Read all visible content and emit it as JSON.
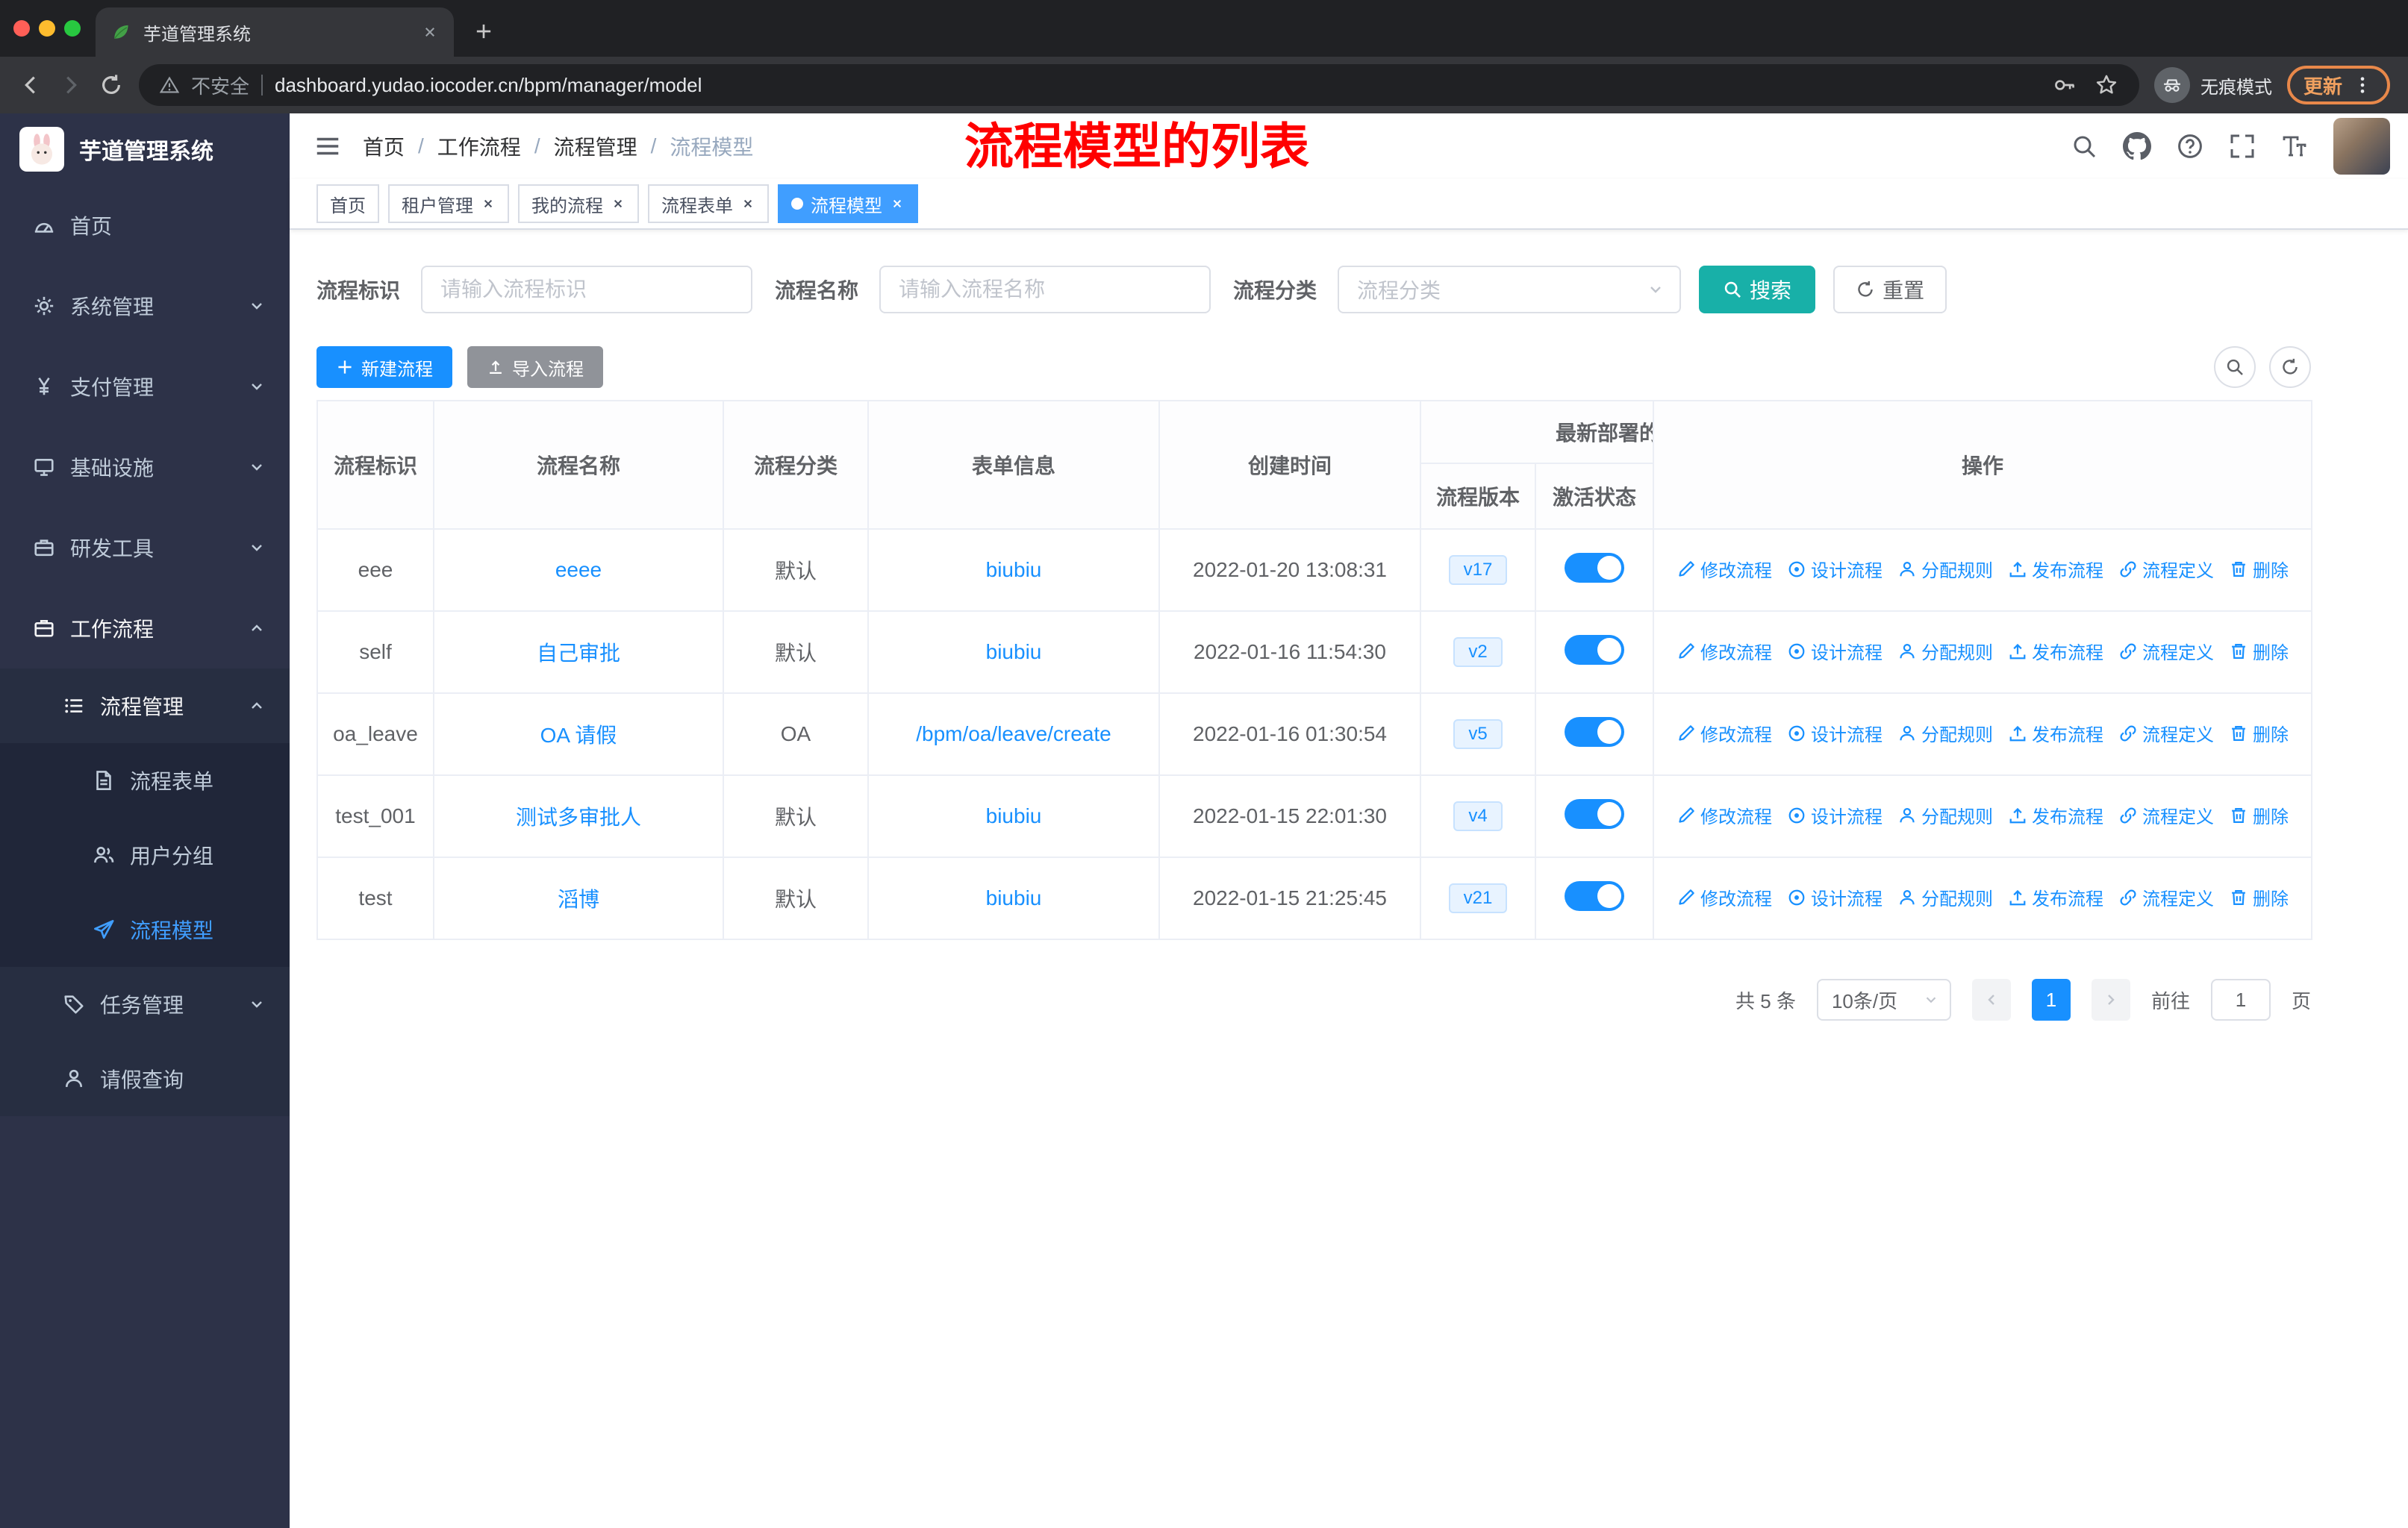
{
  "colors": {
    "accent_blue": "#1890ff",
    "menu_active_blue": "#409eff",
    "search_button_teal": "#18b0a8",
    "sidebar_background": "#2d3248",
    "annotation_red": "#ff0000",
    "update_orange": "#e8884a"
  },
  "browser": {
    "tab_title": "芋道管理系统",
    "security_label": "不安全",
    "url": "dashboard.yudao.iocoder.cn/bpm/manager/model",
    "incognito_label": "无痕模式",
    "update_label": "更新"
  },
  "sidebar": {
    "logo_title": "芋道管理系统",
    "items": [
      {
        "label": "首页"
      },
      {
        "label": "系统管理"
      },
      {
        "label": "支付管理"
      },
      {
        "label": "基础设施"
      },
      {
        "label": "研发工具"
      },
      {
        "label": "工作流程"
      },
      {
        "label": "流程管理"
      },
      {
        "label": "流程表单"
      },
      {
        "label": "用户分组"
      },
      {
        "label": "流程模型"
      },
      {
        "label": "任务管理"
      },
      {
        "label": "请假查询"
      }
    ]
  },
  "header": {
    "breadcrumb": [
      "首页",
      "工作流程",
      "流程管理",
      "流程模型"
    ],
    "annotation": "流程模型的列表"
  },
  "tabs": [
    {
      "label": "首页"
    },
    {
      "label": "租户管理"
    },
    {
      "label": "我的流程"
    },
    {
      "label": "流程表单"
    },
    {
      "label": "流程模型"
    }
  ],
  "filters": {
    "key_label": "流程标识",
    "key_placeholder": "请输入流程标识",
    "name_label": "流程名称",
    "name_placeholder": "请输入流程名称",
    "category_label": "流程分类",
    "category_placeholder": "流程分类",
    "search_label": "搜索",
    "reset_label": "重置"
  },
  "toolbar": {
    "create_label": "新建流程",
    "import_label": "导入流程"
  },
  "table": {
    "headers": {
      "key": "流程标识",
      "name": "流程名称",
      "category": "流程分类",
      "form": "表单信息",
      "created": "创建时间",
      "group": "最新部署的",
      "version": "流程版本",
      "active": "激活状态",
      "ops": "操作"
    },
    "actions": [
      "修改流程",
      "设计流程",
      "分配规则",
      "发布流程",
      "流程定义",
      "删除"
    ],
    "rows": [
      {
        "key": "eee",
        "name": "eeee",
        "category": "默认",
        "form": "biubiu",
        "created": "2022-01-20 13:08:31",
        "version": "v17"
      },
      {
        "key": "self",
        "name": "自己审批",
        "category": "默认",
        "form": "biubiu",
        "created": "2022-01-16 11:54:30",
        "version": "v2"
      },
      {
        "key": "oa_leave",
        "name": "OA 请假",
        "category": "OA",
        "form": "/bpm/oa/leave/create",
        "created": "2022-01-16 01:30:54",
        "version": "v5"
      },
      {
        "key": "test_001",
        "name": "测试多审批人",
        "category": "默认",
        "form": "biubiu",
        "created": "2022-01-15 22:01:30",
        "version": "v4"
      },
      {
        "key": "test",
        "name": "滔博",
        "category": "默认",
        "form": "biubiu",
        "created": "2022-01-15 21:25:45",
        "version": "v21"
      }
    ]
  },
  "pagination": {
    "total": "共 5 条",
    "page_size": "10条/页",
    "current_page": "1",
    "goto_label": "前往",
    "goto_value": "1",
    "page_unit": "页"
  }
}
